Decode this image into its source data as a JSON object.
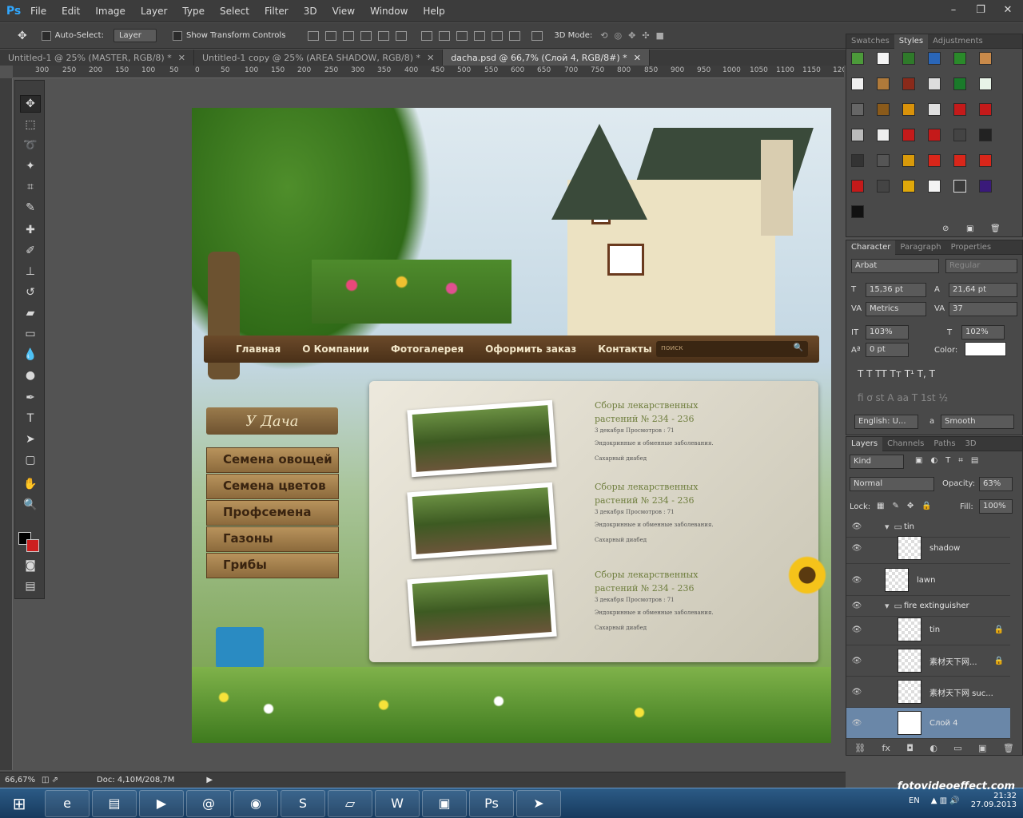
{
  "app": {
    "logo": "Ps"
  },
  "menu": [
    "File",
    "Edit",
    "Image",
    "Layer",
    "Type",
    "Select",
    "Filter",
    "3D",
    "View",
    "Window",
    "Help"
  ],
  "options": {
    "auto_select": "Auto-Select:",
    "layer_dropdown": "Layer",
    "show_transform": "Show Transform Controls",
    "mode_3d": "3D Mode:"
  },
  "tabs": [
    {
      "label": "Untitled-1 @ 25% (MASTER, RGB/8) *"
    },
    {
      "label": "Untitled-1 copy @ 25% (AREA SHADOW, RGB/8) *"
    },
    {
      "label": "dacha.psd @ 66,7% (Слой 4, RGB/8#) *"
    }
  ],
  "ruler": [
    "300",
    "250",
    "200",
    "150",
    "100",
    "50",
    "0",
    "50",
    "100",
    "150",
    "200",
    "250",
    "300",
    "350",
    "400",
    "450",
    "500",
    "550",
    "600",
    "650",
    "700",
    "750",
    "800",
    "850",
    "900",
    "950",
    "1000",
    "1050",
    "1100",
    "1150",
    "120"
  ],
  "site": {
    "nav": [
      "Главная",
      "О Компании",
      "Фотогалерея",
      "Оформить заказ",
      "Контакты"
    ],
    "search_placeholder": "поиск",
    "logo": "У Дача",
    "menu": [
      "Семена овощей",
      "Семена цветов",
      "Профсемена",
      "Газоны",
      "Грибы"
    ],
    "posts": [
      {
        "title1": "Сборы лекарственных",
        "title2": "растений № 234 - 236",
        "meta": "3 декабря  Просмотров : 71",
        "line1": "Эндокринные  и обменные заболевания.",
        "line2": "Сахарный диабед"
      },
      {
        "title1": "Сборы лекарственных",
        "title2": "растений № 234 - 236",
        "meta": "3 декабря  Просмотров : 71",
        "line1": "Эндокринные  и обменные заболевания.",
        "line2": "Сахарный диабед"
      },
      {
        "title1": "Сборы лекарственных",
        "title2": "растений № 234 - 236",
        "meta": "3 декабря  Просмотров : 71",
        "line1": "Эндокринные  и обменные заболевания.",
        "line2": "Сахарный диабед"
      }
    ]
  },
  "panels": {
    "styles_tabs": [
      "Swatches",
      "Styles",
      "Adjustments"
    ],
    "char_tabs": [
      "Character",
      "Paragraph",
      "Properties"
    ],
    "font": "Arbat",
    "font_style": "Regular",
    "size": "15,36 pt",
    "leading": "21,64 pt",
    "kerning": "Metrics",
    "tracking": "37",
    "vscale": "103%",
    "hscale": "102%",
    "baseline": "0 pt",
    "color_label": "Color:",
    "language": "English: U...",
    "aa_label": "a",
    "antialias": "Smooth",
    "layers_tabs": [
      "Layers",
      "Channels",
      "Paths",
      "3D"
    ],
    "kind": "Kind",
    "blend": "Normal",
    "opacity_label": "Opacity:",
    "opacity": "63%",
    "lock_label": "Lock:",
    "fill_label": "Fill:",
    "fill": "100%",
    "layers": [
      {
        "name": "tin",
        "type": "group",
        "indent": 1
      },
      {
        "name": "shadow",
        "type": "layer",
        "indent": 2
      },
      {
        "name": "lawn",
        "type": "layer",
        "indent": 1
      },
      {
        "name": "fire extinguisher",
        "type": "group",
        "indent": 1
      },
      {
        "name": "tin",
        "type": "layer",
        "indent": 2,
        "locked": true
      },
      {
        "name": "素材天下网...",
        "type": "layer",
        "indent": 2,
        "locked": true
      },
      {
        "name": "素材天下网 suc...",
        "type": "layer",
        "indent": 2
      },
      {
        "name": "Слой 4",
        "type": "layer",
        "indent": 2,
        "selected": true
      }
    ]
  },
  "status": {
    "zoom": "66,67%",
    "doc": "Doc: 4,10M/208,7M"
  },
  "taskbar": {
    "lang": "EN",
    "time": "21:32",
    "date": "27.09.2013",
    "watermark": "fotovideoeffect.com"
  },
  "colors": {
    "fg": "#000000",
    "bg": "#cc1f1f",
    "accent": "#31a8ff"
  }
}
